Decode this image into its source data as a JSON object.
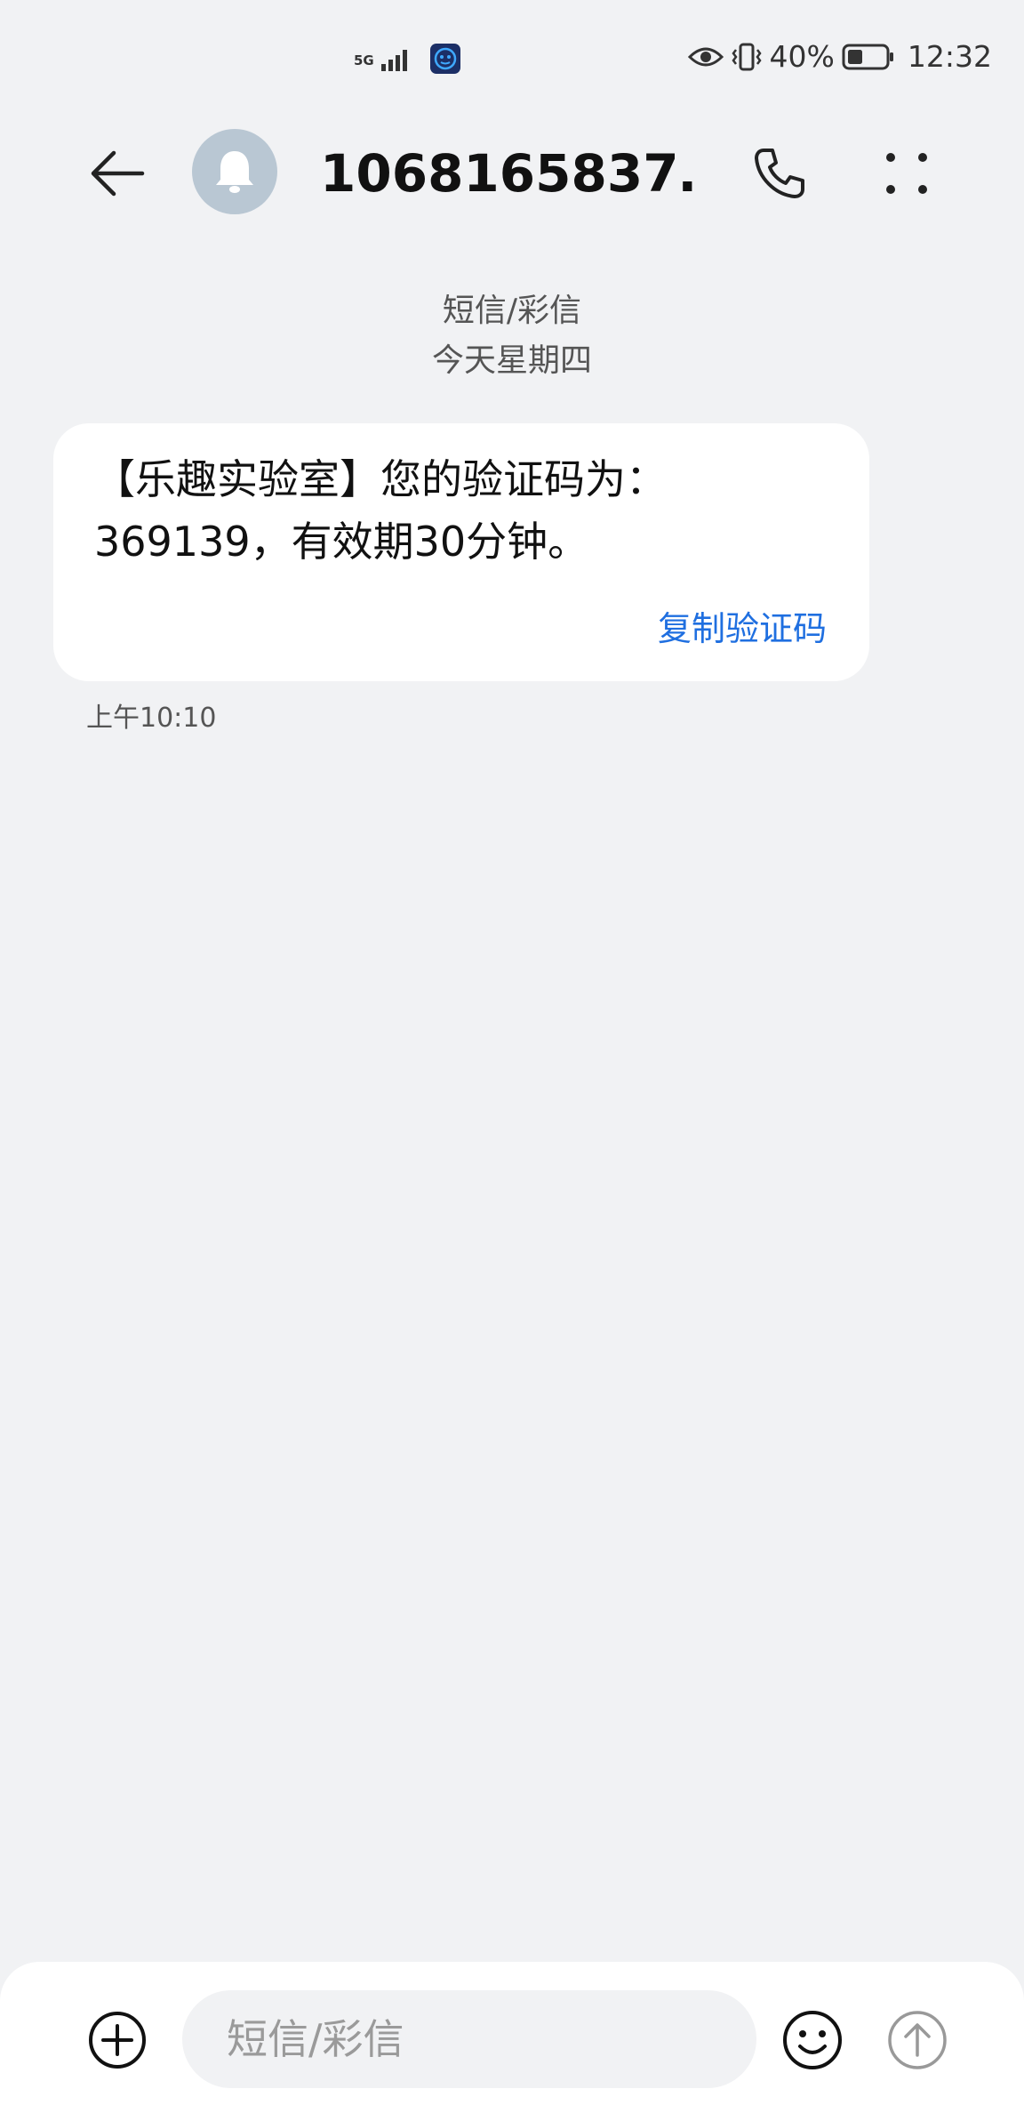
{
  "status_bar": {
    "network_label": "5G",
    "battery_percent": "40%",
    "time": "12:32",
    "battery_level": 0.4
  },
  "header": {
    "contact": "1068165837…"
  },
  "conversation": {
    "message_type": "短信/彩信",
    "date_label": "今天星期四",
    "messages": [
      {
        "text": "【乐趣实验室】您的验证码为：369139，有效期30分钟。",
        "action_label": "复制验证码",
        "time": "上午10:10"
      }
    ]
  },
  "composer": {
    "placeholder": "短信/彩信"
  },
  "colors": {
    "background": "#f1f2f4",
    "bubble": "#ffffff",
    "accent": "#1f6fe0",
    "avatar": "#b9c7d3"
  }
}
